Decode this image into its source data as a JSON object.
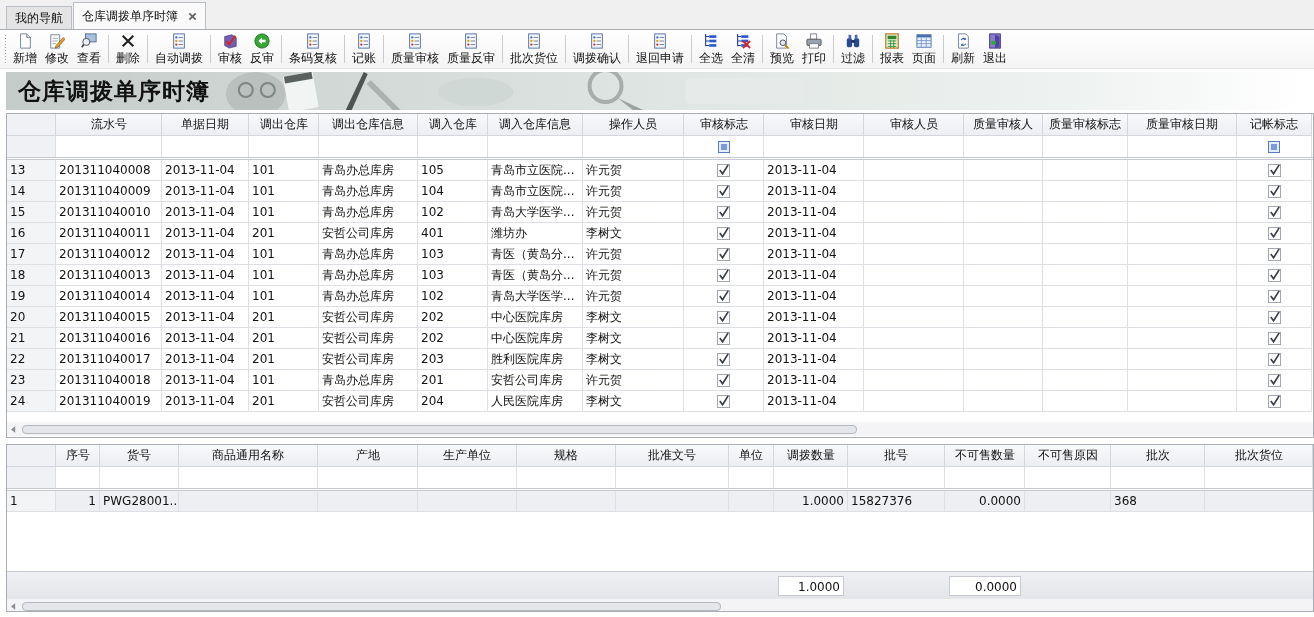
{
  "tabs": [
    {
      "label": "我的导航",
      "selected": false
    },
    {
      "label": "仓库调拨单序时簿",
      "selected": true
    }
  ],
  "toolbar": [
    [
      {
        "label": "新增",
        "kind": "new"
      },
      {
        "label": "修改",
        "kind": "edit"
      },
      {
        "label": "查看",
        "kind": "view"
      }
    ],
    [
      {
        "label": "删除",
        "kind": "delete"
      }
    ],
    [
      {
        "label": "自动调拨",
        "kind": "list"
      }
    ],
    [
      {
        "label": "审核",
        "kind": "audit"
      },
      {
        "label": "反审",
        "kind": "back"
      }
    ],
    [
      {
        "label": "条码复核",
        "kind": "list"
      }
    ],
    [
      {
        "label": "记账",
        "kind": "list"
      }
    ],
    [
      {
        "label": "质量审核",
        "kind": "list"
      },
      {
        "label": "质量反审",
        "kind": "list"
      }
    ],
    [
      {
        "label": "批次货位",
        "kind": "list"
      }
    ],
    [
      {
        "label": "调拨确认",
        "kind": "list"
      }
    ],
    [
      {
        "label": "退回申请",
        "kind": "list"
      }
    ],
    [
      {
        "label": "全选",
        "kind": "select_all"
      },
      {
        "label": "全清",
        "kind": "clear_all"
      }
    ],
    [
      {
        "label": "预览",
        "kind": "preview"
      },
      {
        "label": "打印",
        "kind": "print"
      }
    ],
    [
      {
        "label": "过滤",
        "kind": "filter"
      }
    ],
    [
      {
        "label": "报表",
        "kind": "report"
      },
      {
        "label": "页面",
        "kind": "page"
      }
    ],
    [
      {
        "label": "刷新",
        "kind": "refresh"
      },
      {
        "label": "退出",
        "kind": "exit"
      }
    ]
  ],
  "banner": {
    "title": "仓库调拨单序时簿"
  },
  "upper_grid": {
    "columns": [
      {
        "label": "流水号",
        "kind": "text"
      },
      {
        "label": "单据日期",
        "kind": "text"
      },
      {
        "label": "调出仓库",
        "kind": "text"
      },
      {
        "label": "调出仓库信息",
        "kind": "text"
      },
      {
        "label": "调入仓库",
        "kind": "text"
      },
      {
        "label": "调入仓库信息",
        "kind": "text"
      },
      {
        "label": "操作人员",
        "kind": "text"
      },
      {
        "label": "审核标志",
        "kind": "check",
        "filter_indeterminate": true
      },
      {
        "label": "审核日期",
        "kind": "text"
      },
      {
        "label": "审核人员",
        "kind": "text"
      },
      {
        "label": "质量审核人",
        "kind": "text"
      },
      {
        "label": "质量审核标志",
        "kind": "text"
      },
      {
        "label": "质量审核日期",
        "kind": "text"
      },
      {
        "label": "记帐标志",
        "kind": "check",
        "filter_indeterminate": true
      }
    ],
    "rows": [
      {
        "row": "13",
        "cells": [
          "201311040008",
          "2013-11-04",
          "101",
          "青岛办总库房",
          "105",
          "青岛市立医院...",
          "许元贺",
          true,
          "2013-11-04",
          null,
          null,
          null,
          null,
          true
        ]
      },
      {
        "row": "14",
        "cells": [
          "201311040009",
          "2013-11-04",
          "101",
          "青岛办总库房",
          "104",
          "青岛市立医院...",
          "许元贺",
          true,
          "2013-11-04",
          null,
          null,
          null,
          null,
          true
        ]
      },
      {
        "row": "15",
        "cells": [
          "201311040010",
          "2013-11-04",
          "101",
          "青岛办总库房",
          "102",
          "青岛大学医学...",
          "许元贺",
          true,
          "2013-11-04",
          null,
          null,
          null,
          null,
          true
        ]
      },
      {
        "row": "16",
        "cells": [
          "201311040011",
          "2013-11-04",
          "201",
          "安哲公司库房",
          "401",
          "潍坊办",
          "李树文",
          true,
          "2013-11-04",
          null,
          null,
          null,
          null,
          true
        ]
      },
      {
        "row": "17",
        "cells": [
          "201311040012",
          "2013-11-04",
          "101",
          "青岛办总库房",
          "103",
          "青医（黄岛分...",
          "许元贺",
          true,
          "2013-11-04",
          null,
          null,
          null,
          null,
          true
        ]
      },
      {
        "row": "18",
        "cells": [
          "201311040013",
          "2013-11-04",
          "101",
          "青岛办总库房",
          "103",
          "青医（黄岛分...",
          "许元贺",
          true,
          "2013-11-04",
          null,
          null,
          null,
          null,
          true
        ]
      },
      {
        "row": "19",
        "cells": [
          "201311040014",
          "2013-11-04",
          "101",
          "青岛办总库房",
          "102",
          "青岛大学医学...",
          "许元贺",
          true,
          "2013-11-04",
          null,
          null,
          null,
          null,
          true
        ]
      },
      {
        "row": "20",
        "cells": [
          "201311040015",
          "2013-11-04",
          "201",
          "安哲公司库房",
          "202",
          "中心医院库房",
          "李树文",
          true,
          "2013-11-04",
          null,
          null,
          null,
          null,
          true
        ]
      },
      {
        "row": "21",
        "cells": [
          "201311040016",
          "2013-11-04",
          "201",
          "安哲公司库房",
          "202",
          "中心医院库房",
          "李树文",
          true,
          "2013-11-04",
          null,
          null,
          null,
          null,
          true
        ]
      },
      {
        "row": "22",
        "cells": [
          "201311040017",
          "2013-11-04",
          "201",
          "安哲公司库房",
          "203",
          "胜利医院库房",
          "李树文",
          true,
          "2013-11-04",
          null,
          null,
          null,
          null,
          true
        ]
      },
      {
        "row": "23",
        "cells": [
          "201311040018",
          "2013-11-04",
          "101",
          "青岛办总库房",
          "201",
          "安哲公司库房",
          "许元贺",
          true,
          "2013-11-04",
          null,
          null,
          null,
          null,
          true
        ]
      },
      {
        "row": "24",
        "cells": [
          "201311040019",
          "2013-11-04",
          "201",
          "安哲公司库房",
          "204",
          "人民医院库房",
          "李树文",
          true,
          "2013-11-04",
          null,
          null,
          null,
          null,
          true
        ]
      }
    ]
  },
  "lower_grid": {
    "columns": [
      {
        "label": "序号",
        "kind": "number"
      },
      {
        "label": "货号",
        "kind": "text"
      },
      {
        "label": "商品通用名称",
        "kind": "text"
      },
      {
        "label": "产地",
        "kind": "text"
      },
      {
        "label": "生产单位",
        "kind": "text"
      },
      {
        "label": "规格",
        "kind": "text"
      },
      {
        "label": "批准文号",
        "kind": "text"
      },
      {
        "label": "单位",
        "kind": "text"
      },
      {
        "label": "调拨数量",
        "kind": "number",
        "total": "1.0000"
      },
      {
        "label": "批号",
        "kind": "text"
      },
      {
        "label": "不可售数量",
        "kind": "number",
        "total": "0.0000"
      },
      {
        "label": "不可售原因",
        "kind": "text"
      },
      {
        "label": "批次",
        "kind": "text"
      },
      {
        "label": "批次货位",
        "kind": "text"
      }
    ],
    "rows": [
      {
        "row": "1",
        "selected": true,
        "cells": [
          "1",
          "PWG28001...",
          null,
          null,
          null,
          null,
          null,
          null,
          "1.0000",
          "15827376",
          "0.0000",
          null,
          "368",
          null
        ]
      }
    ]
  }
}
